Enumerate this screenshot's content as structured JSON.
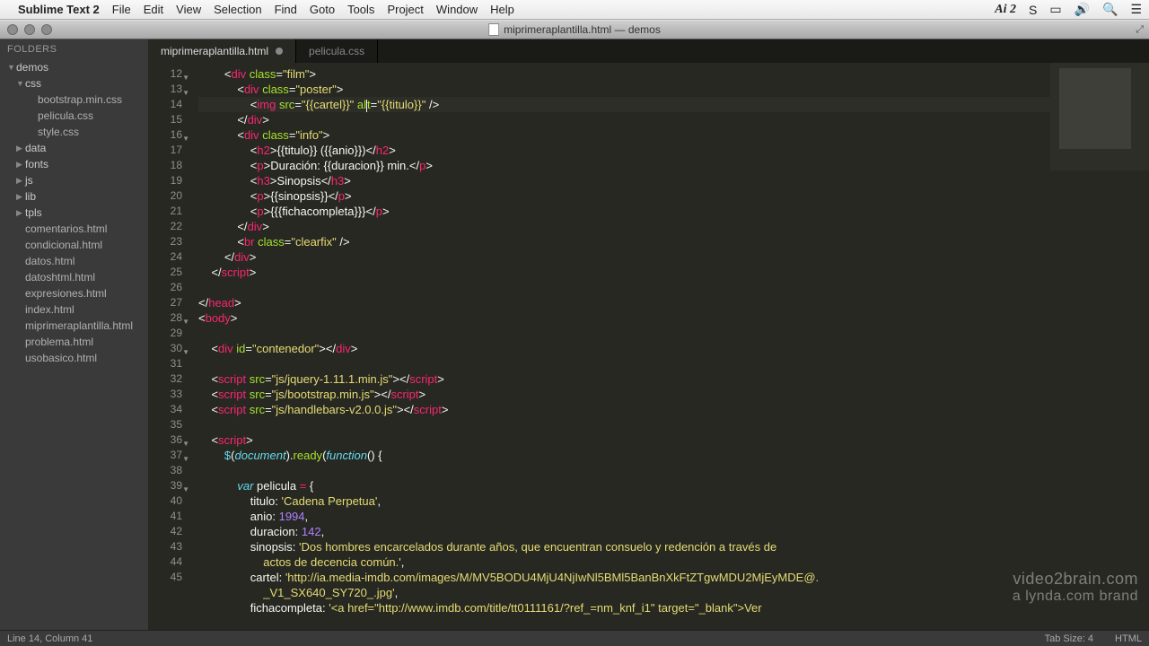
{
  "menubar": {
    "apple": "",
    "appname": "Sublime Text 2",
    "items": [
      "File",
      "Edit",
      "View",
      "Selection",
      "Find",
      "Goto",
      "Tools",
      "Project",
      "Window",
      "Help"
    ],
    "right_ai": "Ai 2",
    "right_s": "S"
  },
  "window": {
    "title": "miprimeraplantilla.html — demos"
  },
  "sidebar": {
    "header": "FOLDERS",
    "tree": [
      {
        "type": "folder",
        "name": "demos",
        "open": true,
        "indent": 0
      },
      {
        "type": "folder",
        "name": "css",
        "open": true,
        "indent": 1
      },
      {
        "type": "file",
        "name": "bootstrap.min.css",
        "indent": 2
      },
      {
        "type": "file",
        "name": "pelicula.css",
        "indent": 2
      },
      {
        "type": "file",
        "name": "style.css",
        "indent": 2
      },
      {
        "type": "folder",
        "name": "data",
        "open": false,
        "indent": 1
      },
      {
        "type": "folder",
        "name": "fonts",
        "open": false,
        "indent": 1
      },
      {
        "type": "folder",
        "name": "js",
        "open": false,
        "indent": 1
      },
      {
        "type": "folder",
        "name": "lib",
        "open": false,
        "indent": 1
      },
      {
        "type": "folder",
        "name": "tpls",
        "open": false,
        "indent": 1
      },
      {
        "type": "file",
        "name": "comentarios.html",
        "indent": 1
      },
      {
        "type": "file",
        "name": "condicional.html",
        "indent": 1
      },
      {
        "type": "file",
        "name": "datos.html",
        "indent": 1
      },
      {
        "type": "file",
        "name": "datoshtml.html",
        "indent": 1
      },
      {
        "type": "file",
        "name": "expresiones.html",
        "indent": 1
      },
      {
        "type": "file",
        "name": "index.html",
        "indent": 1
      },
      {
        "type": "file",
        "name": "miprimeraplantilla.html",
        "indent": 1,
        "active": true
      },
      {
        "type": "file",
        "name": "problema.html",
        "indent": 1
      },
      {
        "type": "file",
        "name": "usobasico.html",
        "indent": 1
      }
    ]
  },
  "tabs": [
    {
      "name": "miprimeraplantilla.html",
      "active": true,
      "dirty": true
    },
    {
      "name": "pelicula.css",
      "active": false,
      "dirty": false
    }
  ],
  "lines": {
    "start": 12,
    "foldable": [
      12,
      13,
      16,
      28,
      30,
      36,
      37,
      39
    ],
    "rows": [
      {
        "n": 12,
        "html": "        <span class='t-punc'>&lt;</span><span class='t-tag'>div</span> <span class='t-attr'>class</span><span class='t-punc'>=</span><span class='t-str'>\"film\"</span><span class='t-punc'>&gt;</span>"
      },
      {
        "n": 13,
        "html": "            <span class='t-punc'>&lt;</span><span class='t-tag'>div</span> <span class='t-attr'>class</span><span class='t-punc'>=</span><span class='t-str'>\"poster\"</span><span class='t-punc'>&gt;</span>"
      },
      {
        "n": 14,
        "hl": true,
        "html": "                <span class='t-punc'>&lt;</span><span class='t-tag'>img</span> <span class='t-attr'>src</span><span class='t-punc'>=</span><span class='t-str'>\"{{cartel}}\"</span> <span class='t-attr'>al<span class='cursor'></span>t</span><span class='t-punc'>=</span><span class='t-str'>\"{{titulo}}\"</span> <span class='t-punc'>/&gt;</span>"
      },
      {
        "n": 15,
        "html": "            <span class='t-punc'>&lt;/</span><span class='t-tag'>div</span><span class='t-punc'>&gt;</span>"
      },
      {
        "n": 16,
        "html": "            <span class='t-punc'>&lt;</span><span class='t-tag'>div</span> <span class='t-attr'>class</span><span class='t-punc'>=</span><span class='t-str'>\"info\"</span><span class='t-punc'>&gt;</span>"
      },
      {
        "n": 17,
        "html": "                <span class='t-punc'>&lt;</span><span class='t-tag'>h2</span><span class='t-punc'>&gt;</span>{{titulo}} ({{anio}})<span class='t-punc'>&lt;/</span><span class='t-tag'>h2</span><span class='t-punc'>&gt;</span>"
      },
      {
        "n": 18,
        "html": "                <span class='t-punc'>&lt;</span><span class='t-tag'>p</span><span class='t-punc'>&gt;</span>Duración: {{duracion}} min.<span class='t-punc'>&lt;/</span><span class='t-tag'>p</span><span class='t-punc'>&gt;</span>"
      },
      {
        "n": 19,
        "html": "                <span class='t-punc'>&lt;</span><span class='t-tag'>h3</span><span class='t-punc'>&gt;</span>Sinopsis<span class='t-punc'>&lt;/</span><span class='t-tag'>h3</span><span class='t-punc'>&gt;</span>"
      },
      {
        "n": 20,
        "html": "                <span class='t-punc'>&lt;</span><span class='t-tag'>p</span><span class='t-punc'>&gt;</span>{{sinopsis}}<span class='t-punc'>&lt;/</span><span class='t-tag'>p</span><span class='t-punc'>&gt;</span>"
      },
      {
        "n": 21,
        "html": "                <span class='t-punc'>&lt;</span><span class='t-tag'>p</span><span class='t-punc'>&gt;</span>{{{fichacompleta}}}<span class='t-punc'>&lt;/</span><span class='t-tag'>p</span><span class='t-punc'>&gt;</span>"
      },
      {
        "n": 22,
        "html": "            <span class='t-punc'>&lt;/</span><span class='t-tag'>div</span><span class='t-punc'>&gt;</span>"
      },
      {
        "n": 23,
        "html": "            <span class='t-punc'>&lt;</span><span class='t-tag'>br</span> <span class='t-attr'>class</span><span class='t-punc'>=</span><span class='t-str'>\"clearfix\"</span> <span class='t-punc'>/&gt;</span>"
      },
      {
        "n": 24,
        "html": "        <span class='t-punc'>&lt;/</span><span class='t-tag'>div</span><span class='t-punc'>&gt;</span>"
      },
      {
        "n": 25,
        "html": "    <span class='t-punc'>&lt;/</span><span class='t-tag'>script</span><span class='t-punc'>&gt;</span>"
      },
      {
        "n": 26,
        "html": " "
      },
      {
        "n": 27,
        "html": "<span class='t-punc'>&lt;/</span><span class='t-tag'>head</span><span class='t-punc'>&gt;</span>"
      },
      {
        "n": 28,
        "html": "<span class='t-punc'>&lt;</span><span class='t-tag'>body</span><span class='t-punc'>&gt;</span>"
      },
      {
        "n": 29,
        "html": " "
      },
      {
        "n": 30,
        "html": "    <span class='t-punc'>&lt;</span><span class='t-tag'>div</span> <span class='t-attr'>id</span><span class='t-punc'>=</span><span class='t-str'>\"contenedor\"</span><span class='t-punc'>&gt;&lt;/</span><span class='t-tag'>div</span><span class='t-punc'>&gt;</span>"
      },
      {
        "n": 31,
        "html": " "
      },
      {
        "n": 32,
        "html": "    <span class='t-punc'>&lt;</span><span class='t-tag'>script</span> <span class='t-attr'>src</span><span class='t-punc'>=</span><span class='t-str'>\"js/jquery-1.11.1.min.js\"</span><span class='t-punc'>&gt;&lt;/</span><span class='t-tag'>script</span><span class='t-punc'>&gt;</span>"
      },
      {
        "n": 33,
        "html": "    <span class='t-punc'>&lt;</span><span class='t-tag'>script</span> <span class='t-attr'>src</span><span class='t-punc'>=</span><span class='t-str'>\"js/bootstrap.min.js\"</span><span class='t-punc'>&gt;&lt;/</span><span class='t-tag'>script</span><span class='t-punc'>&gt;</span>"
      },
      {
        "n": 34,
        "html": "    <span class='t-punc'>&lt;</span><span class='t-tag'>script</span> <span class='t-attr'>src</span><span class='t-punc'>=</span><span class='t-str'>\"js/handlebars-v2.0.0.js\"</span><span class='t-punc'>&gt;&lt;/</span><span class='t-tag'>script</span><span class='t-punc'>&gt;</span>"
      },
      {
        "n": 35,
        "html": " "
      },
      {
        "n": 36,
        "html": "    <span class='t-punc'>&lt;</span><span class='t-tag'>script</span><span class='t-punc'>&gt;</span>"
      },
      {
        "n": 37,
        "html": "        <span class='t-func'>$</span>(<span class='t-kw'>document</span>).<span class='t-name'>ready</span>(<span class='t-kw'>function</span>() {"
      },
      {
        "n": 38,
        "html": " "
      },
      {
        "n": 39,
        "html": "            <span class='t-kw'>var</span> pelicula <span class='t-kw2'>=</span> {"
      },
      {
        "n": 40,
        "html": "                titulo: <span class='t-str'>'Cadena Perpetua'</span>,"
      },
      {
        "n": 41,
        "html": "                anio: <span class='t-num'>1994</span>,"
      },
      {
        "n": 42,
        "html": "                duracion: <span class='t-num'>142</span>,"
      },
      {
        "n": 43,
        "html": "                sinopsis: <span class='t-str'>'Dos hombres encarcelados durante años, que encuentran consuelo y redención a través de</span>"
      },
      {
        "n": "",
        "html": "<span class='t-str'>                    actos de decencia común.'</span>,"
      },
      {
        "n": 44,
        "html": "                cartel: <span class='t-str'>'http://ia.media-imdb.com/images/M/MV5BODU4MjU4NjIwNl5BMl5BanBnXkFtZTgwMDU2MjEyMDE@.</span>"
      },
      {
        "n": "",
        "html": "<span class='t-str'>                    _V1_SX640_SY720_.jpg'</span>,"
      },
      {
        "n": 45,
        "html": "                fichacompleta: <span class='t-str'>'&lt;a href=\"http://www.imdb.com/title/tt0111161/?ref_=nm_knf_i1\" target=\"_blank\"&gt;Ver</span>"
      }
    ]
  },
  "statusbar": {
    "left": "Line 14, Column 41",
    "tabsize": "Tab Size: 4",
    "syntax": "HTML"
  },
  "watermark": {
    "l1": "video2brain.com",
    "l2": "a lynda.com brand"
  }
}
